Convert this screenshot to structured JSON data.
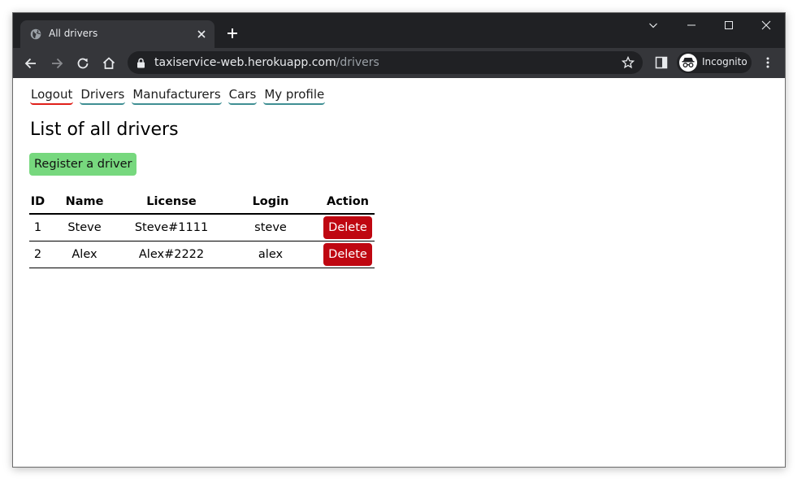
{
  "browser": {
    "tab_title": "All drivers",
    "url_host": "taxiservice-web.herokuapp.com",
    "url_path": "/drivers",
    "profile_label": "Incognito",
    "icons": [
      "globe-icon",
      "close-icon",
      "plus-icon",
      "chevron-down-icon",
      "minimize-icon",
      "maximize-icon",
      "back-icon",
      "forward-icon",
      "reload-icon",
      "home-icon",
      "lock-icon",
      "star-icon",
      "side-panel-icon",
      "incognito-icon",
      "kebab-menu-icon"
    ]
  },
  "nav": {
    "items": [
      {
        "label": "Logout"
      },
      {
        "label": "Drivers"
      },
      {
        "label": "Manufacturers"
      },
      {
        "label": "Cars"
      },
      {
        "label": "My profile"
      }
    ]
  },
  "main": {
    "title": "List of all drivers",
    "register_button": "Register a driver",
    "table": {
      "headers": [
        "ID",
        "Name",
        "License",
        "Login",
        "Action"
      ],
      "rows": [
        {
          "id": "1",
          "name": "Steve",
          "license": "Steve#1111",
          "login": "steve",
          "action": "Delete"
        },
        {
          "id": "2",
          "name": "Alex",
          "license": "Alex#2222",
          "login": "alex",
          "action": "Delete"
        }
      ]
    }
  },
  "colors": {
    "tabstrip": "#202124",
    "toolbar": "#35363a",
    "nav_underline": "#3f8f93",
    "logout_underline": "#e0201a",
    "register_button": "#77d87e",
    "delete_button": "#bf0711"
  }
}
